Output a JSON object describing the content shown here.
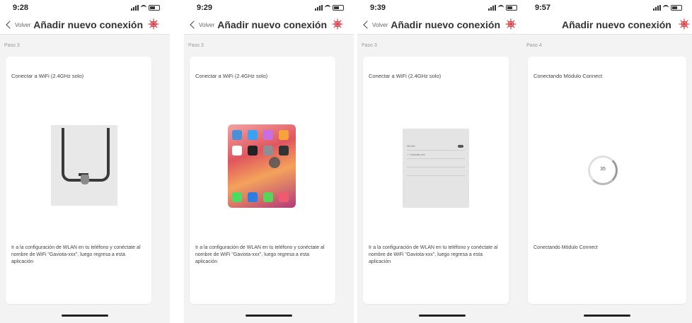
{
  "screens": [
    {
      "time": "9:28",
      "back_label": "Volver",
      "title": "Añadir nuevo conexión",
      "step": "Paso 3",
      "card_title": "Conectar a WiFi (2.4GHz solo)",
      "instruction": "Ir a la configuración de WLAN en tu teléfono y conéctate al nombre de WiFi \"Gaviota-xxx\", luego regresa a esta aplicación"
    },
    {
      "time": "9:29",
      "back_label": "Volver",
      "title": "Añadir nuevo conexión",
      "step": "Paso 3",
      "card_title": "Conectar a WiFi (2.4GHz solo)",
      "instruction": "Ir a la configuración de WLAN en tu teléfono y conéctate al nombre de WiFi \"Gaviota-xxx\", luego regresa a esta aplicación"
    },
    {
      "time": "9:39",
      "back_label": "Volver",
      "title": "Añadir nuevo conexión",
      "step": "Paso 3",
      "card_title": "Conectar a WiFi (2.4GHz solo)",
      "instruction": "Ir a la configuración de WLAN en tu teléfono y conéctate al nombre de WiFi \"Gaviota-xxx\", luego regresa a esta aplicación",
      "settings_rows": [
        "WLAN",
        "✓ Gaviota-xxx"
      ]
    },
    {
      "time": "9:57",
      "title": "Añadir nuevo conexión",
      "step": "Paso 4",
      "card_title": "Conectando Módulo Connect",
      "progress_value": "35",
      "status_text": "Conectando Módulo Connect"
    }
  ],
  "colors": {
    "brand_logo": "#d9363e",
    "background": "#f3f3f3",
    "card": "#ffffff"
  },
  "icons": {
    "back": "chevron-left-icon",
    "logo": "brand-logo-icon"
  }
}
